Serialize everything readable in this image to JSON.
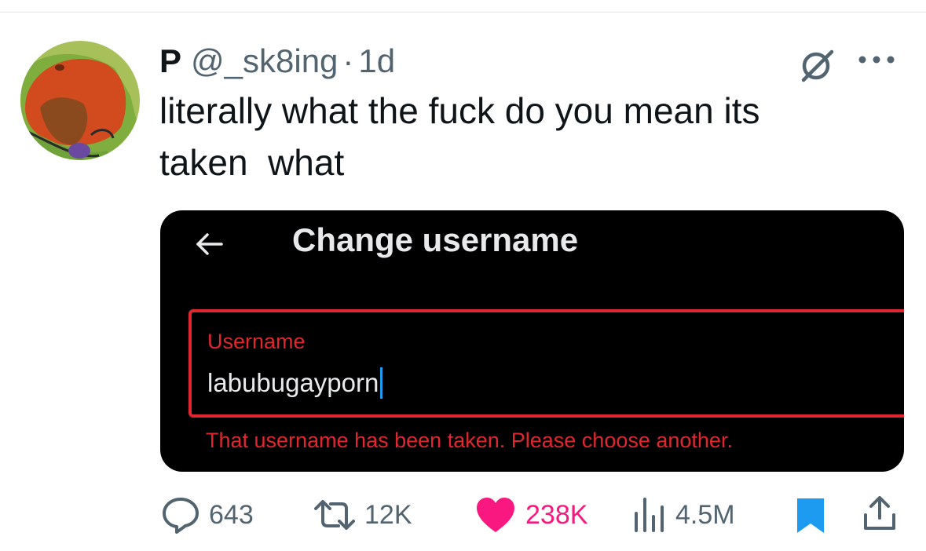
{
  "tweet": {
    "display_name": "P",
    "handle": "@_sk8ing",
    "separator": "·",
    "timestamp": "1d",
    "text": "literally what the fuck do you mean its\ntaken  what"
  },
  "media": {
    "title": "Change username",
    "field_label": "Username",
    "field_value": "labubugayporn",
    "error": "That username has been taken. Please choose another."
  },
  "actions": {
    "replies": "643",
    "retweets": "12K",
    "likes": "238K",
    "views": "4.5M"
  },
  "colors": {
    "like": "#f91880",
    "bookmark": "#1d9bf0",
    "error": "#e0272f",
    "muted": "#536471"
  },
  "icons": [
    "grok-icon",
    "more-icon",
    "back-arrow-icon",
    "reply-icon",
    "retweet-icon",
    "heart-icon",
    "views-icon",
    "bookmark-icon",
    "share-icon"
  ]
}
